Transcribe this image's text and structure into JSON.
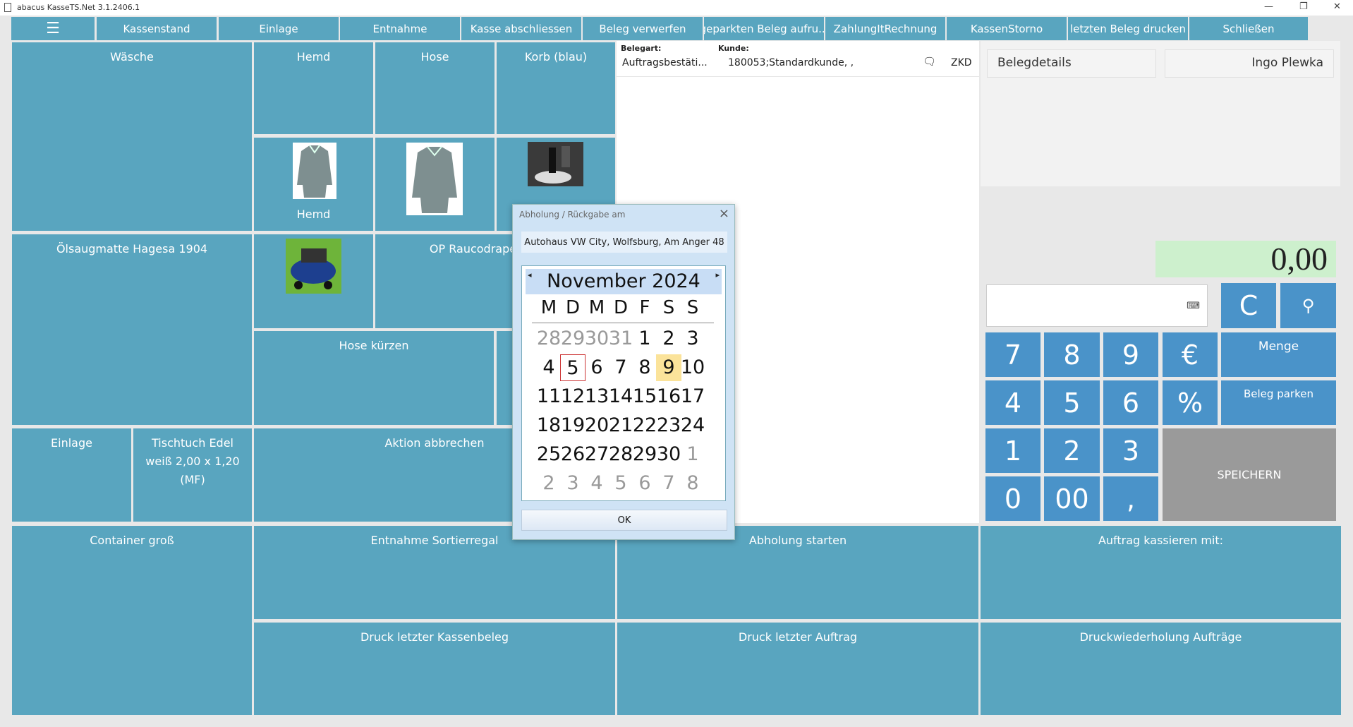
{
  "window": {
    "title": "abacus KasseTS.Net 3.1.2406.1"
  },
  "menu": [
    "Kassenstand",
    "Einlage",
    "Entnahme",
    "Kasse abschliessen",
    "Beleg verwerfen",
    "geparkten Beleg aufru...",
    "ZahlungItRechnung",
    "KassenStorno",
    "letzten Beleg drucken",
    "Schließen"
  ],
  "tiles": {
    "waesche": "Wäsche",
    "hemd": "Hemd",
    "hose": "Hose",
    "korb": "Korb (blau)",
    "hemd2": "Hemd",
    "oelsaug": "Ölsaugmatte Hagesa 1904",
    "op": "OP Raucodrape® Basis",
    "hosekuerzen": "Hose kürzen",
    "einlage": "Einlage",
    "tischtuch": "Tischtuch Edel weiß 2,00 x 1,20 (MF)",
    "aktion": "Aktion abbrechen",
    "container": "Container groß",
    "entnahme_sort": "Entnahme Sortierregal",
    "abholung": "Abholung starten",
    "auftrag": "Auftrag kassieren mit:",
    "druck_kasse": "Druck letzter Kassenbeleg",
    "druck_auftrag": "Druck letzter Auftrag",
    "druck_wdh": "Druckwiederholung Aufträge"
  },
  "receipt": {
    "belegart_label": "Belegart:",
    "kunde_label": "Kunde:",
    "belegart": "Auftragsbestäti...",
    "kunde": "180053;Standardkunde, ,",
    "zkd": "ZKD"
  },
  "panel": {
    "belegdetails": "Belegdetails",
    "user": "Ingo Plewka"
  },
  "display": {
    "amount": "0,00"
  },
  "keypad": {
    "c": "C",
    "menge": "Menge",
    "park": "Beleg parken",
    "save": "SPEICHERN",
    "digits": [
      "7",
      "8",
      "9",
      "€",
      "4",
      "5",
      "6",
      "%",
      "1",
      "2",
      "3",
      "0",
      "00",
      ","
    ]
  },
  "dialog": {
    "title": "Abholung / Rückgabe am",
    "address": "Autohaus VW City, Wolfsburg, Am Anger 48",
    "month": "November 2024",
    "weekdays": [
      "M",
      "D",
      "M",
      "D",
      "F",
      "S",
      "S"
    ],
    "weeks": [
      [
        "28",
        "29",
        "30",
        "31",
        "1",
        "2",
        "3"
      ],
      [
        "4",
        "5",
        "6",
        "7",
        "8",
        "9",
        "10"
      ],
      [
        "11",
        "12",
        "13",
        "14",
        "15",
        "16",
        "17"
      ],
      [
        "18",
        "19",
        "20",
        "21",
        "22",
        "23",
        "24"
      ],
      [
        "25",
        "26",
        "27",
        "28",
        "29",
        "30",
        "1"
      ],
      [
        "2",
        "3",
        "4",
        "5",
        "6",
        "7",
        "8"
      ]
    ],
    "today": "5",
    "selected": "9",
    "ok": "OK"
  }
}
